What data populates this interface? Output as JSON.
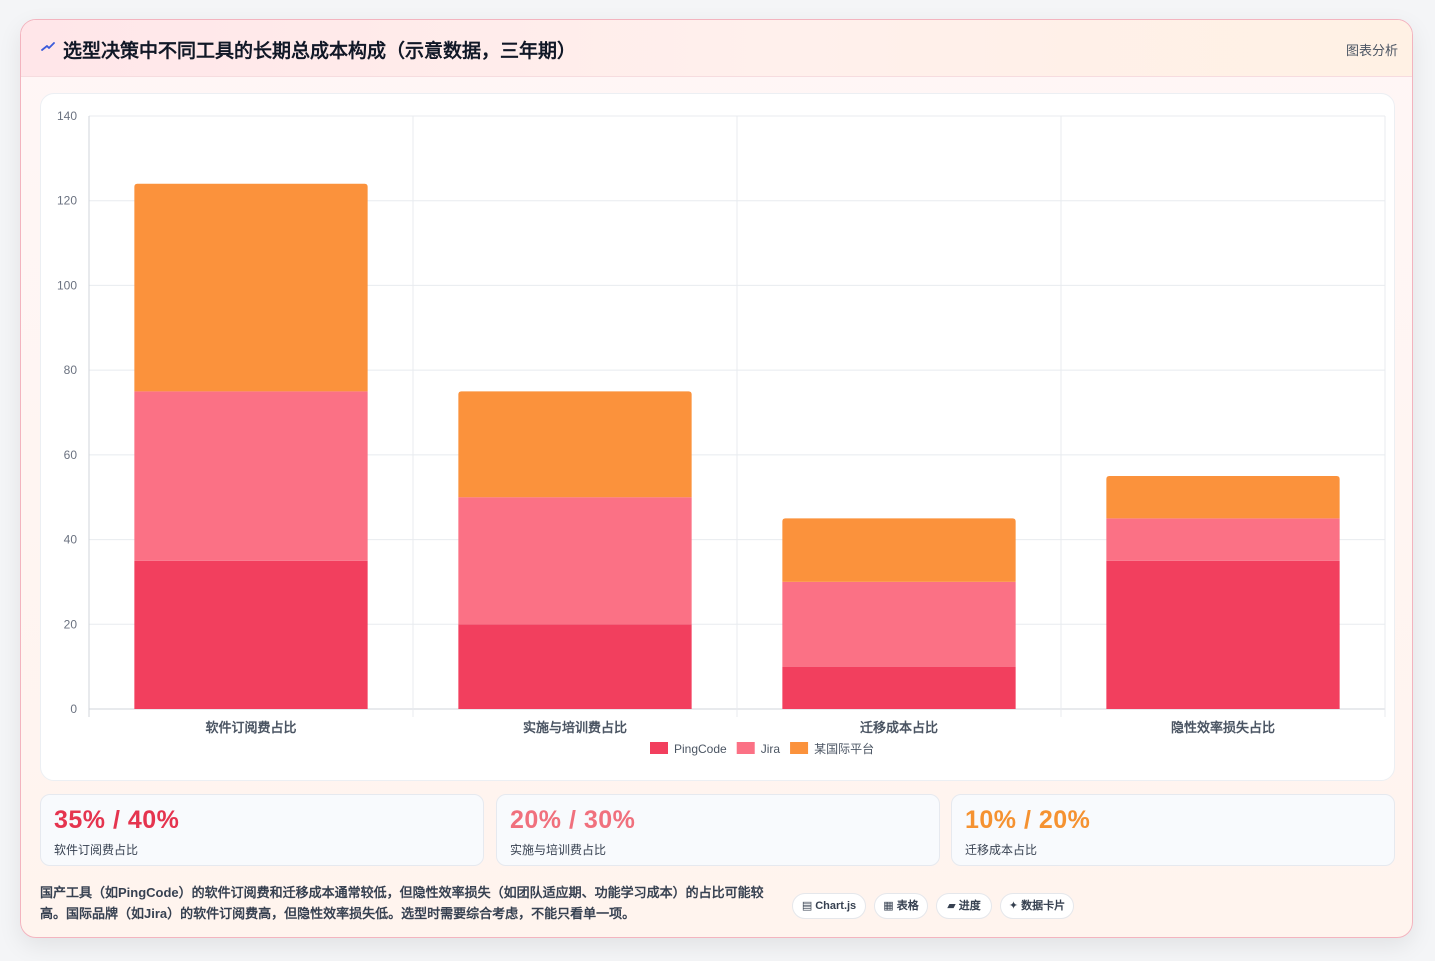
{
  "header": {
    "title": "选型决策中不同工具的长期总成本构成（示意数据，三年期）",
    "action_label": "图表分析",
    "accent": "#3b5bdb"
  },
  "chart_data": {
    "type": "bar",
    "stacked": true,
    "categories": [
      "软件订阅费占比",
      "实施与培训费占比",
      "迁移成本占比",
      "隐性效率损失占比"
    ],
    "series": [
      {
        "name": "PingCode",
        "values": [
          35,
          20,
          10,
          35
        ],
        "color": "#f23f5e"
      },
      {
        "name": "Jira",
        "values": [
          40,
          30,
          20,
          10
        ],
        "color": "#fb7185"
      },
      {
        "name": "某国际平台",
        "values": [
          49,
          25,
          15,
          10
        ],
        "color": "#fb923c"
      }
    ],
    "ylim": [
      0,
      140
    ],
    "yticks": [
      0,
      20,
      40,
      60,
      80,
      100,
      120,
      140
    ],
    "grid": true,
    "legend": "bottom"
  },
  "stats": [
    {
      "value": "35% / 40%",
      "label": "软件订阅费占比",
      "color": "#e5344f"
    },
    {
      "value": "20% / 30%",
      "label": "实施与培训费占比",
      "color": "#f0707d"
    },
    {
      "value": "10% / 20%",
      "label": "迁移成本占比",
      "color": "#f59231"
    }
  ],
  "note": "国产工具（如PingCode）的软件订阅费和迁移成本通常较低，但隐性效率损失（如团队适应期、功能学习成本）的占比可能较高。国际品牌（如Jira）的软件订阅费高，但隐性效率损失低。选型时需要综合考虑，不能只看单一项。",
  "tags": [
    {
      "icon": "▤",
      "label": "Chart.js"
    },
    {
      "icon": "▦",
      "label": "表格"
    },
    {
      "icon": "▰",
      "label": "进度"
    },
    {
      "icon": "✦",
      "label": "数据卡片"
    }
  ]
}
